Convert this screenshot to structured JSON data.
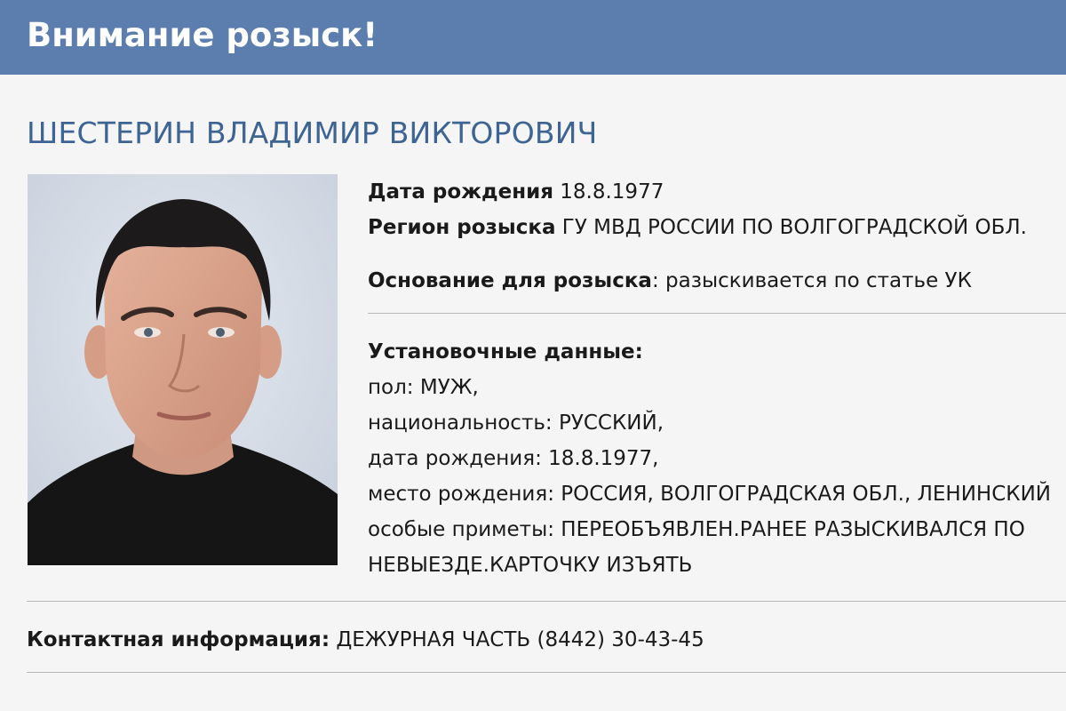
{
  "header": {
    "title": "Внимание розыск!"
  },
  "person": {
    "name": "ШЕСТЕРИН ВЛАДИМИР ВИКТОРОВИЧ"
  },
  "details": {
    "birth_date_label": "Дата рождения",
    "birth_date_value": "18.8.1977",
    "region_label": "Регион розыска",
    "region_value": "ГУ МВД РОССИИ ПО ВОЛГОГРАДСКОЙ ОБЛ.",
    "basis_label": "Основание для розыска",
    "basis_value": ": разыскивается по статье УК",
    "id_data_label": "Установочные данные:",
    "lines": [
      "пол: МУЖ,",
      "национальность: РУССКИЙ,",
      "дата рождения: 18.8.1977,",
      "место рождения: РОССИЯ, ВОЛГОГРАДСКАЯ ОБЛ., ЛЕНИНСКИЙ",
      "особые приметы: ПЕРЕОБЪЯВЛЕН.РАНЕЕ РАЗЫСКИВАЛСЯ ПО",
      "НЕВЫЕЗДЕ.КАРТОЧКУ ИЗЪЯТЬ"
    ]
  },
  "contact": {
    "label": "Контактная информация:",
    "value": "ДЕЖУРНАЯ ЧАСТЬ (8442) 30-43-45"
  },
  "colors": {
    "header_bg": "#5b7eae",
    "name_color": "#3d6493",
    "page_bg": "#f5f5f5"
  }
}
